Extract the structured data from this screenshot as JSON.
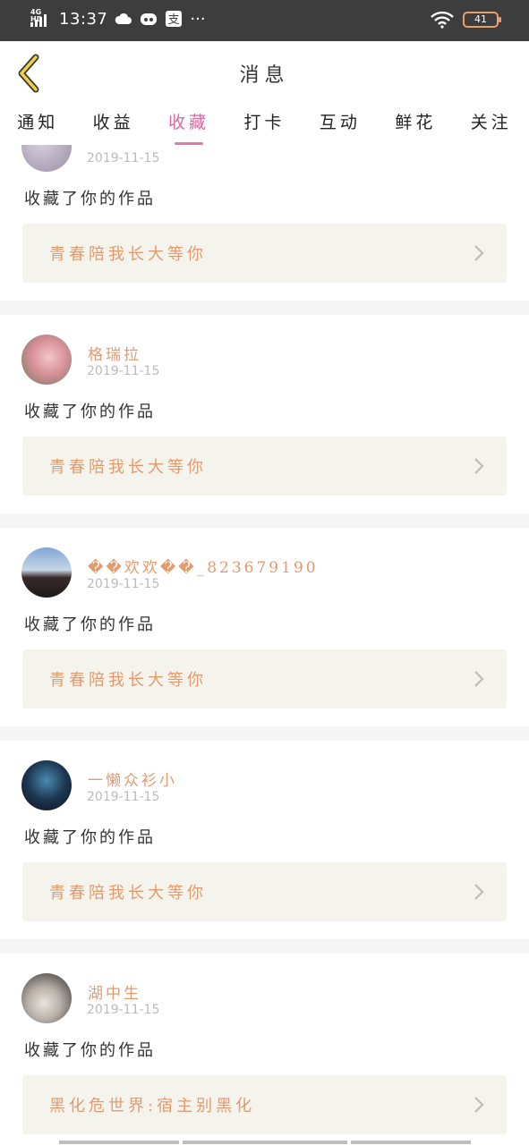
{
  "status_bar": {
    "network": "4G HD",
    "time": "13:37",
    "battery": "41",
    "more": "···"
  },
  "header": {
    "back_icon": "chevron-left-icon",
    "title": "消息"
  },
  "tabs": [
    {
      "label": "通知",
      "active": false
    },
    {
      "label": "收益",
      "active": false
    },
    {
      "label": "收藏",
      "active": true
    },
    {
      "label": "打卡",
      "active": false
    },
    {
      "label": "互动",
      "active": false
    },
    {
      "label": "鲜花",
      "active": false
    },
    {
      "label": "关注",
      "active": false
    }
  ],
  "colors": {
    "accent": "#d967a3",
    "username": "#e39a6e",
    "work_bg": "#f5f4ec",
    "status_bar_bg": "#3d3d3d"
  },
  "messages": [
    {
      "user": "",
      "date": "2019-11-15",
      "action": "收藏了你的作品",
      "work": "青春陪我长大等你"
    },
    {
      "user": "格瑞拉",
      "date": "2019-11-15",
      "action": "收藏了你的作品",
      "work": "青春陪我长大等你"
    },
    {
      "user": "��欢欢��_823679190",
      "date": "2019-11-15",
      "action": "收藏了你的作品",
      "work": "青春陪我长大等你"
    },
    {
      "user": "一懒众衫小",
      "date": "2019-11-15",
      "action": "收藏了你的作品",
      "work": "青春陪我长大等你"
    },
    {
      "user": "湖中生",
      "date": "2019-11-15",
      "action": "收藏了你的作品",
      "work": "黑化危世界:宿主别黑化"
    }
  ]
}
